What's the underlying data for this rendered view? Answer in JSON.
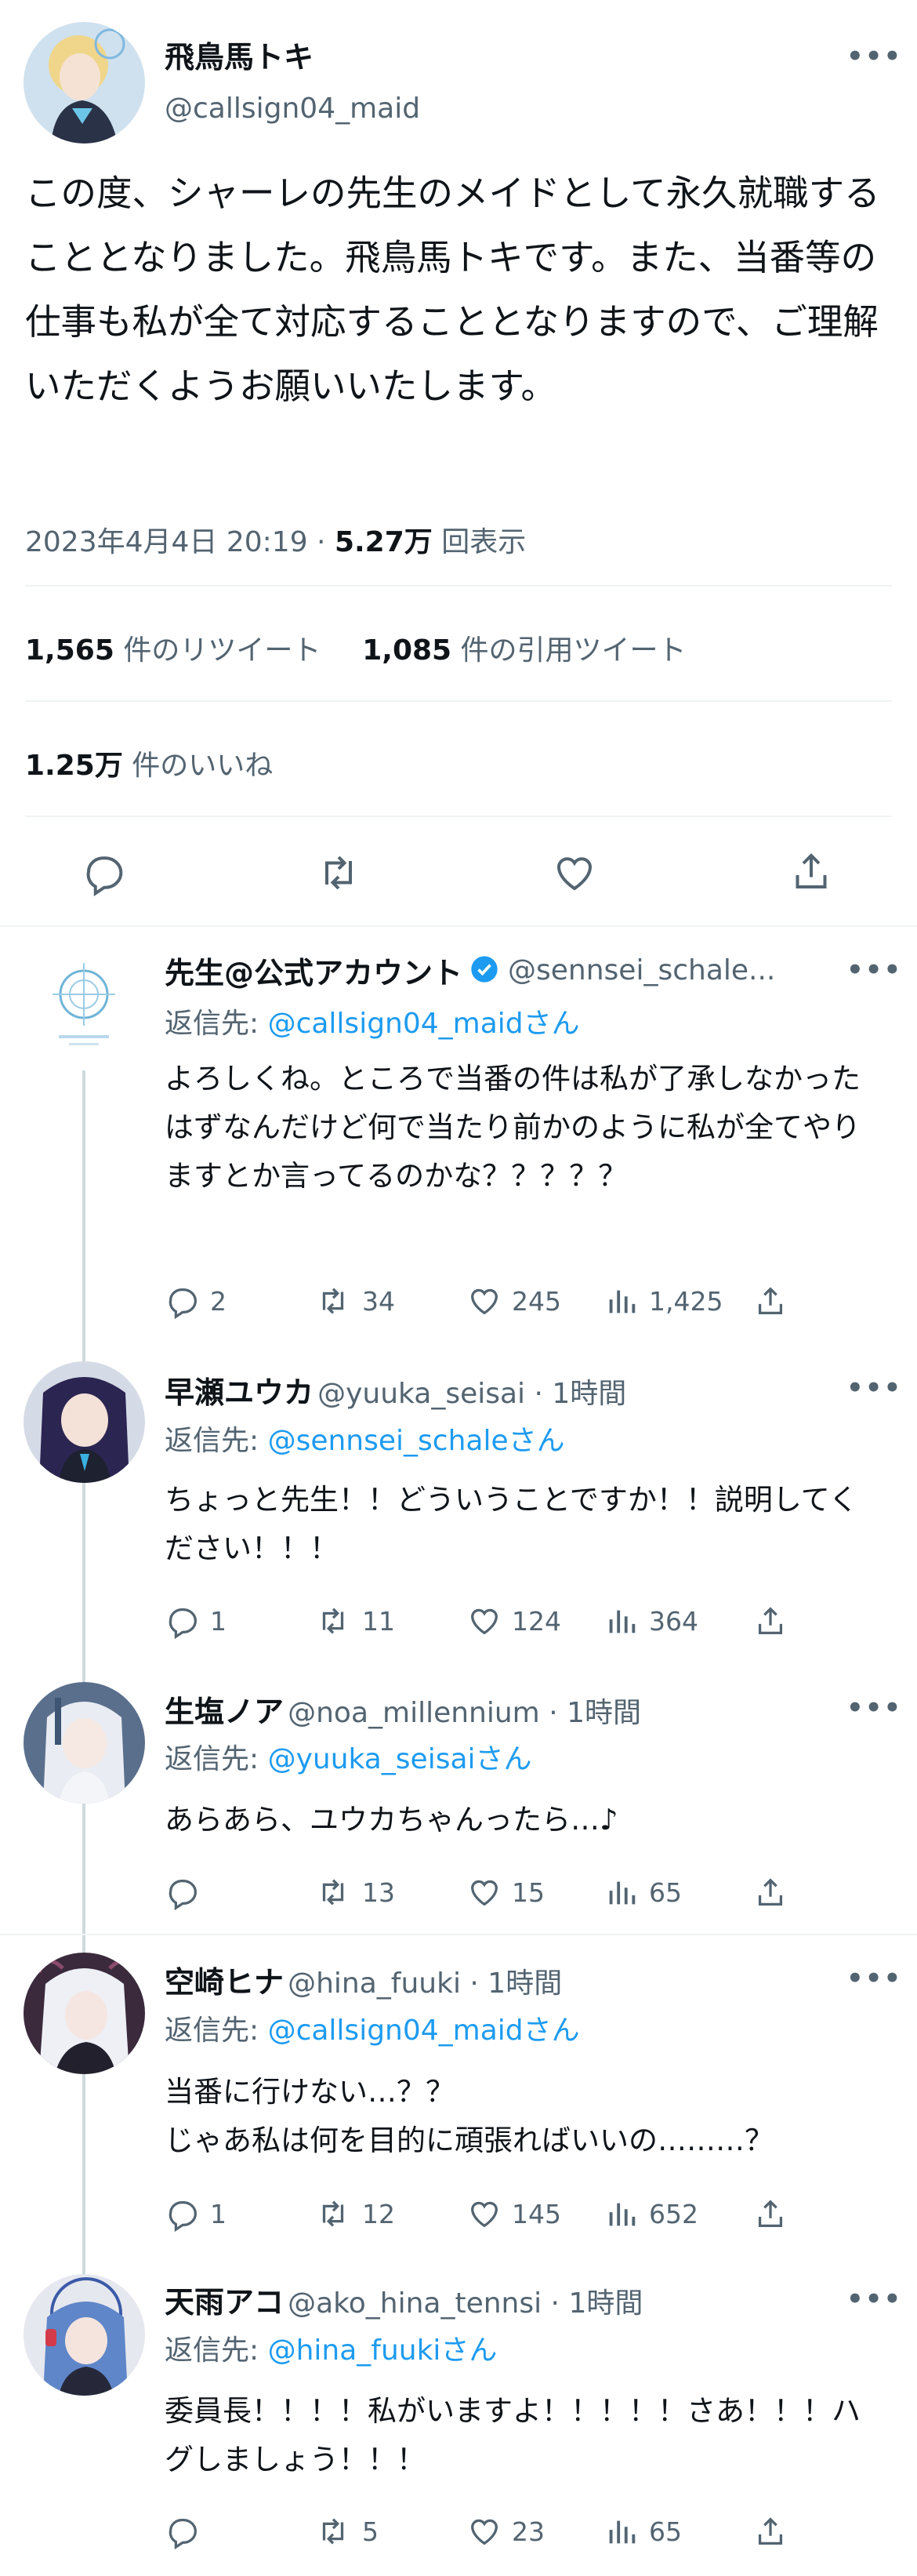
{
  "main_tweet": {
    "author_name": "飛鳥馬トキ",
    "handle": "@callsign04_maid",
    "text": "この度、シャーレの先生のメイドとして永久就職することとなりました。飛鳥馬トキです。また、当番等の仕事も私が全て対応することとなりますので、ご理解いただくようお願いいたします。",
    "datetime": "2023年4月4日 20:19 · ",
    "views_count": "5.27万",
    "views_label": " 回表示",
    "retweets_count": "1,565",
    "retweets_label": " 件のリツイート",
    "quotes_count": "1,085",
    "quotes_label": " 件の引用ツイート",
    "likes_count": "1.25万",
    "likes_label": " 件のいいね",
    "more_label": "•••"
  },
  "replies": [
    {
      "author_name": "先生@公式アカウント",
      "handle": "@sennsei_schale...",
      "time": "",
      "verified": true,
      "reply_to_prefix": "返信先: ",
      "reply_to_handle": "@callsign04_maidさん",
      "text": "よろしくね。ところで当番の件は私が了承しなかったはずなんだけど何で当たり前かのように私が全てやりますとか言ってるのかな？？？？？",
      "replies": "2",
      "retweets": "34",
      "likes": "245",
      "views": "1,425"
    },
    {
      "author_name": "早瀬ユウカ",
      "handle": "@yuuka_seisai",
      "time": " · 1時間",
      "reply_to_prefix": "返信先: ",
      "reply_to_handle": "@sennsei_schaleさん",
      "text": "ちょっと先生！！どういうことですか！！説明してください！！！",
      "replies": "1",
      "retweets": "11",
      "likes": "124",
      "views": "364"
    },
    {
      "author_name": "生塩ノア",
      "handle": "@noa_millennium",
      "time": " · 1時間",
      "reply_to_prefix": "返信先: ",
      "reply_to_handle": "@yuuka_seisaiさん",
      "text": "あらあら、ユウカちゃんったら…♪",
      "replies": "",
      "retweets": "13",
      "likes": "15",
      "views": "65"
    },
    {
      "author_name": "空崎ヒナ",
      "handle": "@hina_fuuki",
      "time": " · 1時間",
      "reply_to_prefix": "返信先: ",
      "reply_to_handle": "@callsign04_maidさん",
      "text": "当番に行けない…？？\nじゃあ私は何を目的に頑張ればいいの………？",
      "replies": "1",
      "retweets": "12",
      "likes": "145",
      "views": "652"
    },
    {
      "author_name": "天雨アコ",
      "handle": "@ako_hina_tennsi",
      "time": " · 1時間",
      "reply_to_prefix": "返信先: ",
      "reply_to_handle": "@hina_fuukiさん",
      "text": "委員長！！！！私がいますよ！！！！！さあ！！！ハグしましょう！！！",
      "replies": "",
      "retweets": "5",
      "likes": "23",
      "views": "65"
    }
  ],
  "colors": {
    "accent": "#1d9bf0",
    "secondary_text": "#536471",
    "divider": "#eff3f4"
  },
  "icons": [
    "reply-icon",
    "retweet-icon",
    "like-icon",
    "share-icon",
    "views-icon",
    "verified-badge-icon",
    "more-icon"
  ]
}
